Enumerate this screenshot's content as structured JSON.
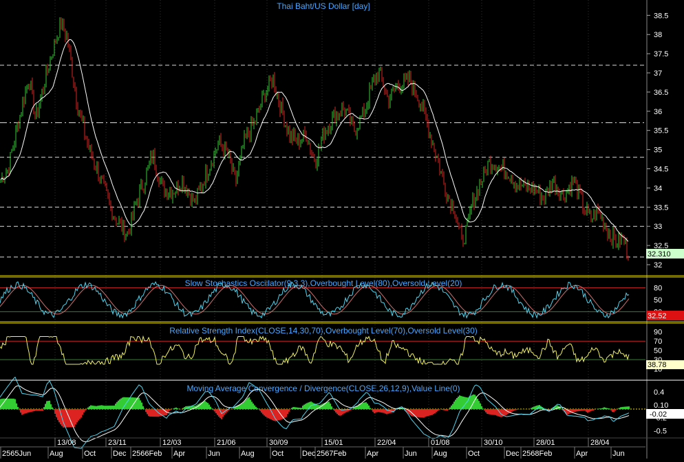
{
  "colors": {
    "background": "#000000",
    "panel_border": "#e6d400",
    "title": "#4aa8ff",
    "axis_text": "#ffffff",
    "up_candle": "#33cc33",
    "down_candle": "#dd2222",
    "moving_average": "#ffffff",
    "stoch_k": "#4fd6f0",
    "stoch_d": "#d07070",
    "rsi": "#f0f060",
    "macd": "#4fd6f0",
    "signal": "#ffffff",
    "hist_up": "#33cc33",
    "hist_down": "#dd2222",
    "price_badge": "#ccffcc",
    "stoch_badge": "#dd1111",
    "rsi_badge": "#ffffcc",
    "macd_badge": "#ffffff",
    "ob_line": "#cc2222",
    "os_line": "#2a8a2a",
    "zero_line": "#ffe000"
  },
  "chart_data": [
    {
      "type": "candlestick",
      "title": "Thai Baht/US Dollar [day]",
      "ylim": [
        32,
        38.9
      ],
      "y_ticks": [
        "38.5",
        "38",
        "37.5",
        "37",
        "36.5",
        "36",
        "35.5",
        "35",
        "34.5",
        "34",
        "33.5",
        "33",
        "32.5",
        "32"
      ],
      "last_value_label": "32.310",
      "moving_average": "white line",
      "horizontal_levels": [
        37.2,
        35.7,
        34.8,
        33.5,
        33.0,
        32.2
      ],
      "pivots": [
        [
          0,
          34.2
        ],
        [
          12,
          34.5
        ],
        [
          25,
          35.6
        ],
        [
          42,
          36.9
        ],
        [
          52,
          35.8
        ],
        [
          72,
          37.3
        ],
        [
          88,
          38.3
        ],
        [
          98,
          37.9
        ],
        [
          112,
          36.2
        ],
        [
          128,
          35.1
        ],
        [
          145,
          34.3
        ],
        [
          160,
          33.5
        ],
        [
          172,
          33.1
        ],
        [
          186,
          32.8
        ],
        [
          198,
          33.6
        ],
        [
          210,
          34.2
        ],
        [
          222,
          34.9
        ],
        [
          236,
          34.0
        ],
        [
          250,
          33.9
        ],
        [
          265,
          34.2
        ],
        [
          283,
          33.6
        ],
        [
          298,
          34.3
        ],
        [
          318,
          35.2
        ],
        [
          333,
          34.8
        ],
        [
          342,
          34.1
        ],
        [
          355,
          35.2
        ],
        [
          372,
          35.8
        ],
        [
          388,
          36.6
        ],
        [
          396,
          36.9
        ],
        [
          408,
          36.1
        ],
        [
          420,
          35.4
        ],
        [
          432,
          35.2
        ],
        [
          445,
          35.4
        ],
        [
          458,
          34.7
        ],
        [
          472,
          35.5
        ],
        [
          486,
          35.9
        ],
        [
          500,
          36.1
        ],
        [
          515,
          35.5
        ],
        [
          530,
          36.0
        ],
        [
          542,
          36.8
        ],
        [
          552,
          37.0
        ],
        [
          564,
          36.3
        ],
        [
          578,
          36.7
        ],
        [
          596,
          36.8
        ],
        [
          612,
          36.2
        ],
        [
          625,
          35.4
        ],
        [
          638,
          34.6
        ],
        [
          648,
          33.9
        ],
        [
          660,
          33.5
        ],
        [
          671,
          32.6
        ],
        [
          678,
          32.9
        ],
        [
          688,
          33.7
        ],
        [
          700,
          34.2
        ],
        [
          708,
          34.6
        ],
        [
          716,
          34.7
        ],
        [
          728,
          34.5
        ],
        [
          740,
          34.4
        ],
        [
          752,
          34.1
        ],
        [
          765,
          34.0
        ],
        [
          778,
          34.0
        ],
        [
          790,
          33.7
        ],
        [
          804,
          34.2
        ],
        [
          818,
          33.8
        ],
        [
          834,
          34.2
        ],
        [
          846,
          33.6
        ],
        [
          858,
          33.2
        ],
        [
          870,
          33.4
        ],
        [
          882,
          32.9
        ],
        [
          895,
          32.6
        ],
        [
          906,
          32.7
        ],
        [
          912,
          32.3
        ]
      ]
    },
    {
      "type": "line",
      "title": "Slow Stochastics Oscillator(9,3,3),Overbought Level(80),Oversold Level(20)",
      "series": [
        "%K",
        "%D"
      ],
      "ylim": [
        0,
        100
      ],
      "y_ticks": [
        "80",
        "50",
        "20"
      ],
      "overbought": 80,
      "oversold": 20,
      "last_value_label": "32.52"
    },
    {
      "type": "line",
      "title": "Relative Strength Index(CLOSE,14,30,70),Overbought Level(70),Oversold Level(30)",
      "ylim": [
        0,
        100
      ],
      "y_ticks": [
        "90",
        "70",
        "50",
        "30",
        "10"
      ],
      "overbought": 70,
      "oversold": 30,
      "last_value_label": "38.78"
    },
    {
      "type": "line",
      "title": "Moving Average Convergence / Divergence(CLOSE,26,12,9),Value Line(0)",
      "ylim": [
        -0.7,
        0.5
      ],
      "y_ticks": [
        "0.4",
        "0.10",
        "-0.2",
        "-0.5"
      ],
      "zero_line": 0,
      "last_value_label": "-0.02"
    }
  ],
  "x_axis": {
    "upper_labels": [
      "13/08",
      "23/11",
      "12/03",
      "21/06",
      "30/09",
      "15/01",
      "22/04",
      "01/08",
      "30/10",
      "28/01",
      "28/04"
    ],
    "lower_labels": [
      "2565Jun",
      "Aug",
      "Oct",
      "Dec",
      "2566Feb",
      "Apr",
      "Jun",
      "Aug",
      "Oct",
      "Dec",
      "2567Feb",
      "Apr",
      "Jun",
      "Aug",
      "Oct",
      "Dec",
      "2568Feb",
      "Apr",
      "Jun"
    ]
  }
}
